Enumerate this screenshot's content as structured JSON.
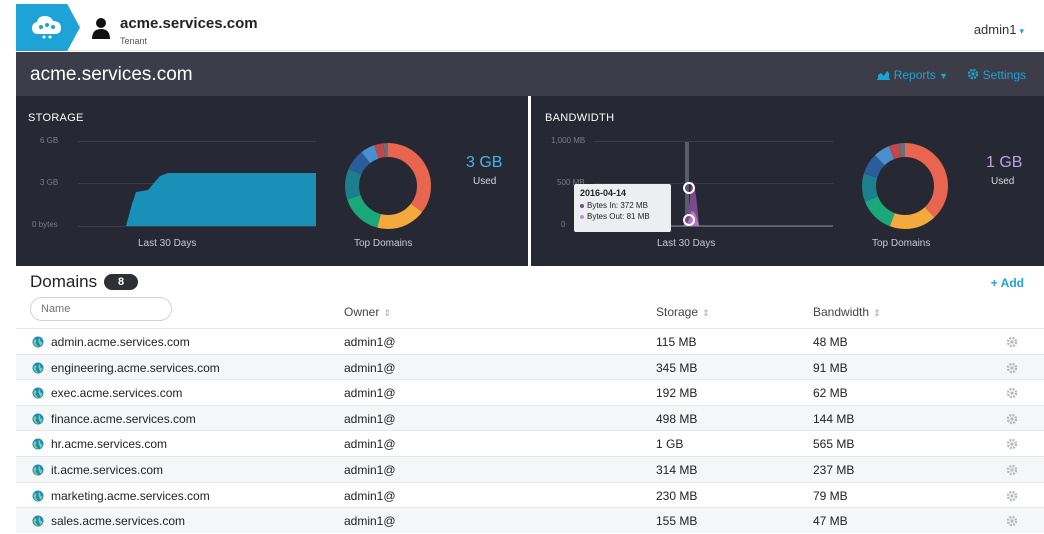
{
  "header": {
    "tenant_name": "acme.services.com",
    "tenant_type": "Tenant",
    "user": "admin1",
    "user_caret": "▾"
  },
  "titlebar": {
    "title": "acme.services.com",
    "reports_label": "Reports",
    "settings_label": "Settings"
  },
  "storage": {
    "label": "STORAGE",
    "ticks": [
      "6 GB",
      "3 GB",
      "0 bytes"
    ],
    "caption": "Last 30 Days",
    "donut_caption": "Top Domains",
    "value": "3 GB",
    "value_label": "Used"
  },
  "bandwidth": {
    "label": "BANDWIDTH",
    "ticks": [
      "1,000 MB",
      "500 MB",
      "0"
    ],
    "caption": "Last 30 Days",
    "donut_caption": "Top Domains",
    "value": "1 GB",
    "value_label": "Used",
    "tooltip": {
      "date": "2016-04-14",
      "bytes_in": "Bytes In: 372 MB",
      "bytes_out": "Bytes Out: 81 MB"
    }
  },
  "domains": {
    "title": "Domains",
    "count": "8",
    "add_label": "Add",
    "filter_placeholder": "Name",
    "columns": {
      "owner": "Owner",
      "storage": "Storage",
      "bandwidth": "Bandwidth"
    },
    "rows": [
      {
        "name": "admin.acme.services.com",
        "owner": "admin1@",
        "storage": "115 MB",
        "bandwidth": "48 MB"
      },
      {
        "name": "engineering.acme.services.com",
        "owner": "admin1@",
        "storage": "345 MB",
        "bandwidth": "91 MB"
      },
      {
        "name": "exec.acme.services.com",
        "owner": "admin1@",
        "storage": "192 MB",
        "bandwidth": "62 MB"
      },
      {
        "name": "finance.acme.services.com",
        "owner": "admin1@",
        "storage": "498 MB",
        "bandwidth": "144 MB"
      },
      {
        "name": "hr.acme.services.com",
        "owner": "admin1@",
        "storage": "1 GB",
        "bandwidth": "565 MB"
      },
      {
        "name": "it.acme.services.com",
        "owner": "admin1@",
        "storage": "314 MB",
        "bandwidth": "237 MB"
      },
      {
        "name": "marketing.acme.services.com",
        "owner": "admin1@",
        "storage": "230 MB",
        "bandwidth": "79 MB"
      },
      {
        "name": "sales.acme.services.com",
        "owner": "admin1@",
        "storage": "155 MB",
        "bandwidth": "47 MB"
      }
    ]
  },
  "colors": {
    "accent": "#1ea3d6",
    "panel_bg": "#262834",
    "titlebar_bg": "#3c3d48",
    "storage_fill": "#1a8fb8",
    "bandwidth_fill": "#7b4a8a",
    "donut": [
      "#e8664f",
      "#f3a93b",
      "#1aa87a",
      "#1c7f8c",
      "#2a5d9a",
      "#4b8fcf",
      "#c0474a",
      "#6a6d7a"
    ]
  },
  "icons": {
    "logo": "cloud-logo-icon",
    "tenant": "user-icon",
    "reports": "chart-icon",
    "settings": "gear-icon",
    "add": "plus-icon",
    "domain": "globe-icon",
    "row_settings": "gear-icon",
    "sort": "sort-icon"
  }
}
